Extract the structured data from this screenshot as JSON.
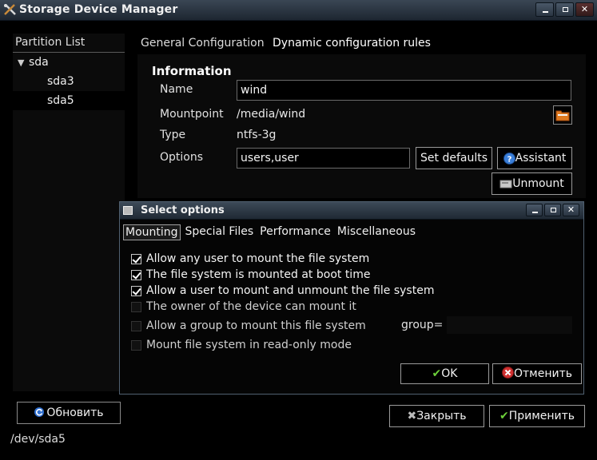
{
  "window": {
    "title": "Storage Device Manager",
    "icon": "tools-icon"
  },
  "left": {
    "header": "Partition List",
    "tree": [
      {
        "label": "sda",
        "expanded": true
      },
      {
        "label": "sda3"
      },
      {
        "label": "sda5",
        "selected": true
      }
    ],
    "refresh_label": "Обновить",
    "status_path": "/dev/sda5"
  },
  "main": {
    "tabs": [
      "General Configuration",
      "Dynamic configuration rules"
    ],
    "info": {
      "title": "Information",
      "name_label": "Name",
      "name_value": "wind",
      "mountpoint_label": "Mountpoint",
      "mountpoint_value": "/media/wind",
      "type_label": "Type",
      "type_value": "ntfs-3g",
      "options_label": "Options",
      "options_value": "users,user",
      "set_defaults_label": "Set defaults",
      "assistant_label": "Assistant",
      "unmount_label": "Unmount"
    },
    "close_label": "Закрыть",
    "apply_label": "Применить"
  },
  "dialog": {
    "title": "Select options",
    "tabs": [
      "Mounting",
      "Special Files",
      "Performance",
      "Miscellaneous"
    ],
    "options": [
      {
        "label": "Allow any user to mount the file system",
        "checked": true
      },
      {
        "label": "The file system is mounted at boot time",
        "checked": true
      },
      {
        "label": "Allow a user to mount and unmount the file system",
        "checked": true
      },
      {
        "label": "The owner of the device can mount it",
        "checked": false
      },
      {
        "label": "Allow a group to mount this file system",
        "checked": false
      },
      {
        "label": "Mount file system in read-only mode",
        "checked": false
      }
    ],
    "group_label": "group=",
    "ok_label": "OK",
    "cancel_label": "Отменить"
  },
  "colors": {
    "background": "#000000",
    "titlebar": "#2a3542",
    "check_green": "#6ccf3a",
    "cancel_red": "#d03030",
    "help_blue": "#3a7ed8"
  }
}
